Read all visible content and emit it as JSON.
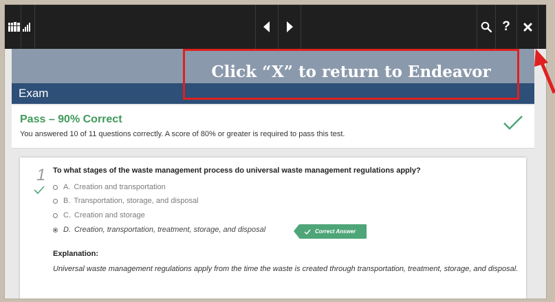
{
  "exam": {
    "label": "Exam"
  },
  "result": {
    "title": "Pass – 90% Correct",
    "description": "You answered 10 of 11 questions correctly. A score of 80% or greater is required to pass this test."
  },
  "question": {
    "number": "1",
    "text": "To what stages of the waste management process do universal waste management regulations apply?",
    "options": [
      {
        "letter": "A.",
        "text": "Creation and transportation",
        "selected": false
      },
      {
        "letter": "B.",
        "text": "Transportation, storage, and disposal",
        "selected": false
      },
      {
        "letter": "C.",
        "text": "Creation and storage",
        "selected": false
      },
      {
        "letter": "D.",
        "text": "Creation, transportation, treatment, storage, and disposal",
        "selected": true
      }
    ],
    "correct_badge": "Correct Answer",
    "explanation_heading": "Explanation:",
    "explanation": "Universal waste management regulations apply from the time the waste is created through transportation, treatment, storage, and disposal."
  },
  "toolbar": {
    "icons": [
      "library-icon",
      "signal-icon",
      "previous-icon",
      "next-icon",
      "search-icon",
      "help-icon",
      "close-icon"
    ]
  },
  "annotation": {
    "text": "Click “X” to return to Endeavor"
  },
  "colors": {
    "toolbar": "#1f1f1f",
    "banner": "#8b99ac",
    "exam_bar": "#2d4f78",
    "pass_green": "#3f9a5a",
    "badge_green": "#4ea578",
    "annotation_red": "#e02020"
  }
}
